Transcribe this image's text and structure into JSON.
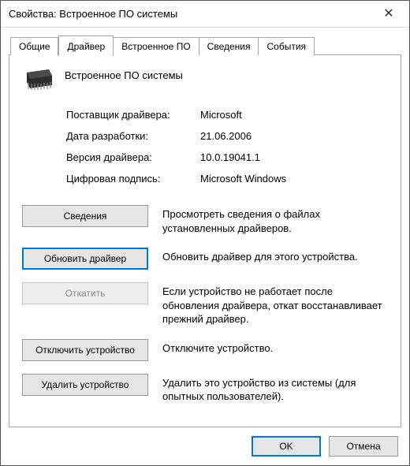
{
  "window": {
    "title": "Свойства: Встроенное ПО системы"
  },
  "tabs": {
    "general": "Общие",
    "driver": "Драйвер",
    "firmware": "Встроенное ПО",
    "details": "Сведения",
    "events": "События"
  },
  "device": {
    "name": "Встроенное ПО системы"
  },
  "info": {
    "provider_label": "Поставщик драйвера:",
    "provider_value": "Microsoft",
    "date_label": "Дата разработки:",
    "date_value": "21.06.2006",
    "version_label": "Версия драйвера:",
    "version_value": "10.0.19041.1",
    "signer_label": "Цифровая подпись:",
    "signer_value": "Microsoft Windows"
  },
  "actions": {
    "details_btn": "Сведения",
    "details_desc": "Просмотреть сведения о файлах установленных драйверов.",
    "update_btn": "Обновить драйвер",
    "update_desc": "Обновить драйвер для этого устройства.",
    "rollback_btn": "Откатить",
    "rollback_desc": "Если устройство не работает после обновления драйвера, откат восстанавливает прежний драйвер.",
    "disable_btn": "Отключить устройство",
    "disable_desc": "Отключите устройство.",
    "uninstall_btn": "Удалить устройство",
    "uninstall_desc": "Удалить это устройство из системы (для опытных пользователей)."
  },
  "footer": {
    "ok": "OK",
    "cancel": "Отмена"
  }
}
